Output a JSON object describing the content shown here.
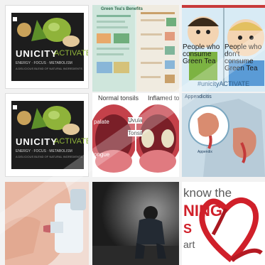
{
  "tiles": [
    {
      "brand_prefix": "UNICITY",
      "brand_suffix": "ACTIVATE",
      "tagline": "ENERGY · FOCUS · METABOLISM",
      "fineprint": "A DELICIOUS BLEND OF NATURAL INGREDIENTS"
    },
    {
      "heading": "Green Tea's Benefits"
    },
    {
      "bubble_left": "People who consume Green Tea",
      "bubble_right": "People who don't consume Green Tea",
      "hashtag": "#unicityACTIVATE"
    },
    {
      "brand_prefix": "UNICITY",
      "brand_suffix": "ACTIVATE",
      "tagline": "ENERGY · FOCUS · METABOLISM",
      "fineprint": "A DELICIOUS BLEND OF NATURAL INGREDIENTS"
    },
    {
      "label_normal": "Normal tonsils",
      "label_inflamed": "Inflamed to",
      "label_palate": "palate",
      "label_uvula": "Uvula",
      "label_tonsil": "Tonsil",
      "label_tongue": "ongue"
    },
    {
      "title": "Appendicitis",
      "label_appendix": "Appendix"
    },
    {},
    {},
    {
      "line1": "know the",
      "line2": "NING",
      "line3": "S",
      "line4": "art"
    }
  ],
  "colors": {
    "accent_green": "#8fb33a",
    "ribbon_red": "#d0202a",
    "skin": "#e8b7a2"
  }
}
